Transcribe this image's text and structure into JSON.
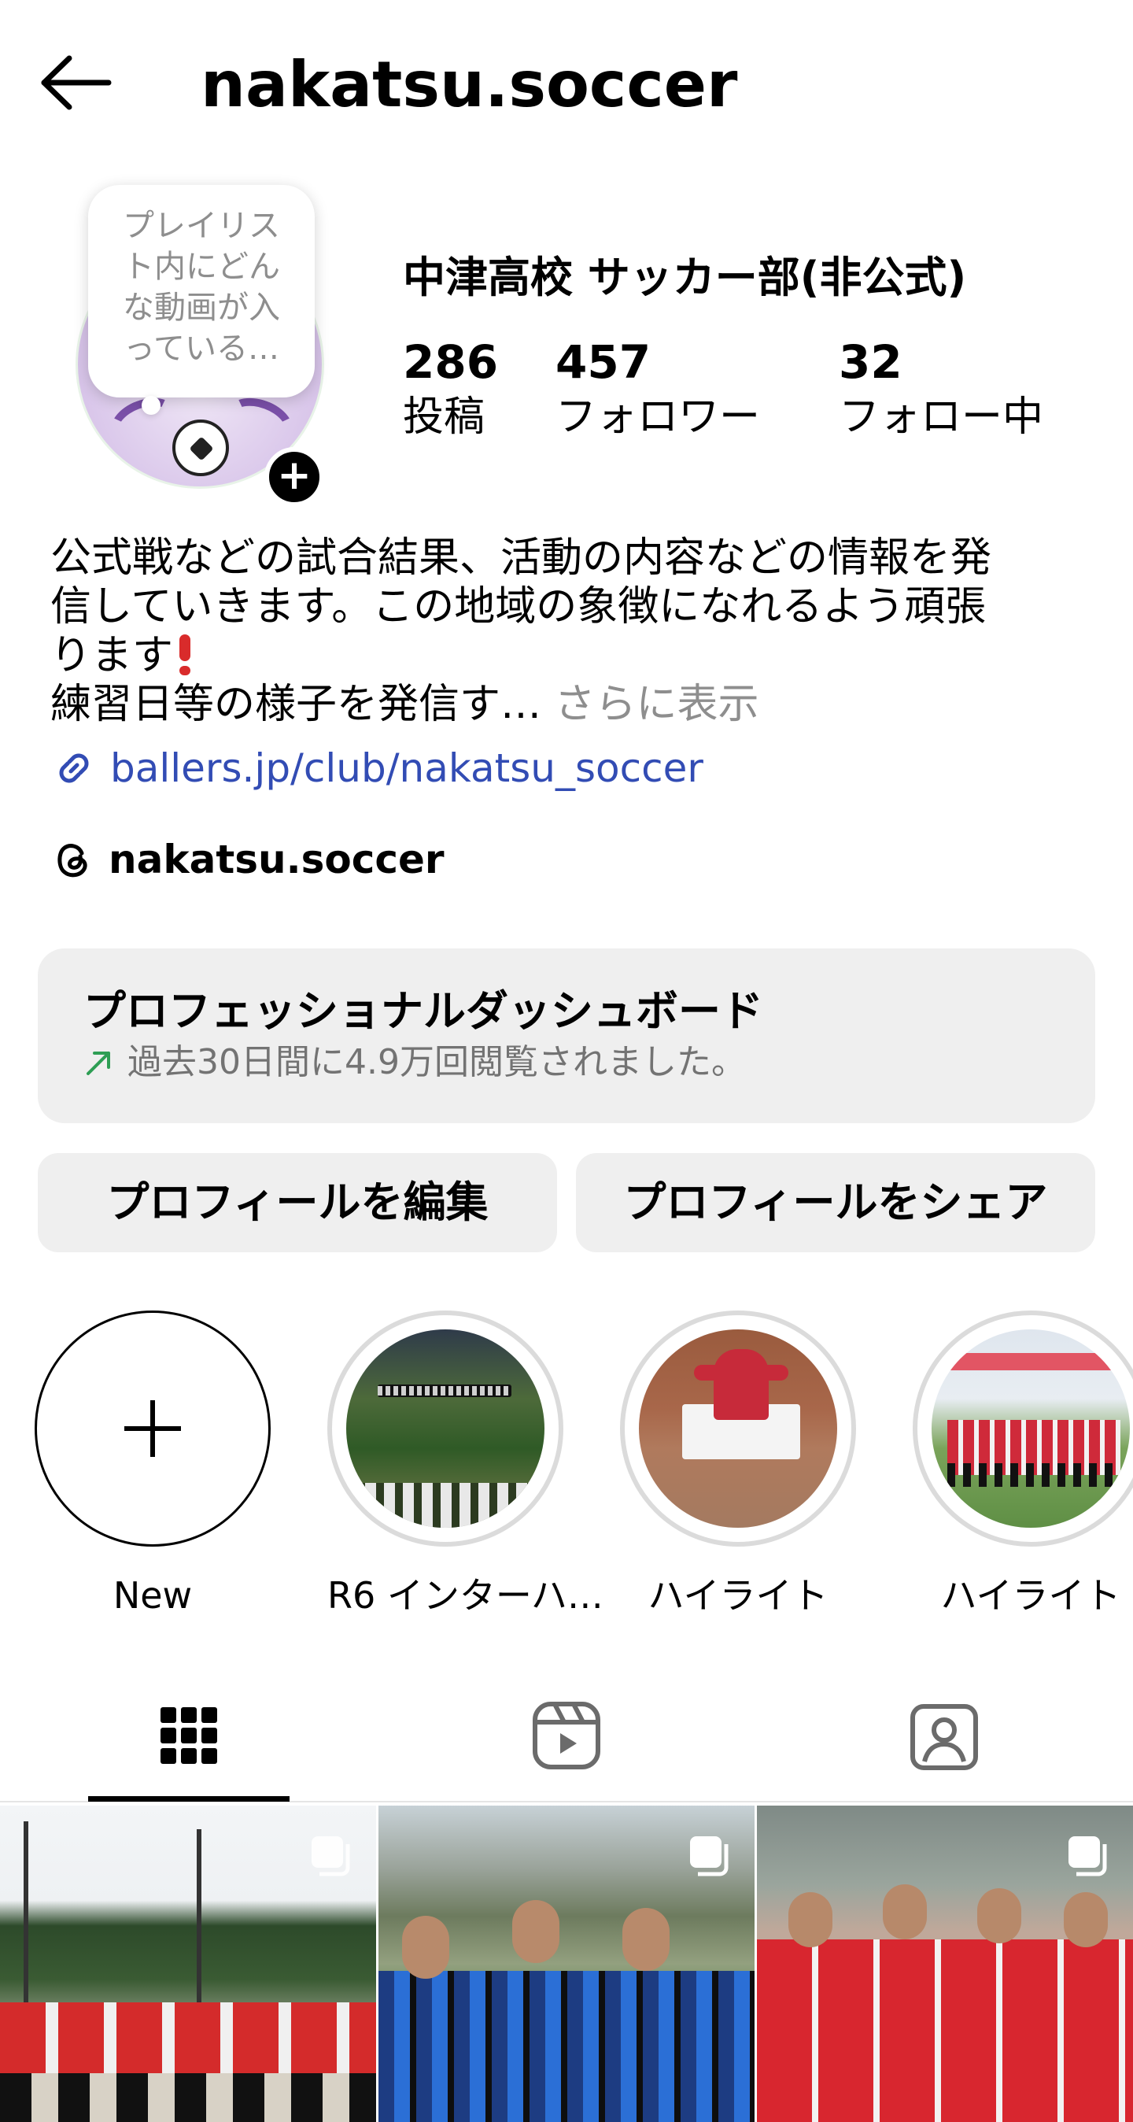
{
  "header": {
    "username": "nakatsu.soccer"
  },
  "profile": {
    "note_text": "プレイリスト内にどんな動画が入っている…",
    "display_name": "中津高校 サッカー部(非公式)",
    "stats": [
      {
        "value": "286",
        "label": "投稿"
      },
      {
        "value": "457",
        "label": "フォロワー"
      },
      {
        "value": "32",
        "label": "フォロー中"
      }
    ],
    "bio_line1": "公式戦などの試合結果、活動の内容などの情報を発",
    "bio_line2": "信していきます。この地域の象徴になれるよう頑張",
    "bio_line3": "ります",
    "bio_line4": "練習日等の様子を発信す…",
    "more_label": " さらに表示",
    "link": "ballers.jp/club/nakatsu_soccer",
    "threads_handle": "nakatsu.soccer"
  },
  "dashboard": {
    "title": "プロフェッショナルダッシュボード",
    "subtitle": "過去30日間に4.9万回閲覧されました。"
  },
  "buttons": {
    "edit_profile": "プロフィールを編集",
    "share_profile": "プロフィールをシェア"
  },
  "highlights": [
    {
      "label": "New"
    },
    {
      "label": "R6 インターハ…"
    },
    {
      "label": "ハイライト"
    },
    {
      "label": "ハイライト"
    }
  ],
  "tabs": [
    "grid-icon",
    "reels-icon",
    "tagged-icon"
  ],
  "colors": {
    "link": "#324cb4",
    "muted": "#737373",
    "button_bg": "#efefef",
    "trend_green": "#2e9e54",
    "exclaim": "#d92b2b"
  }
}
